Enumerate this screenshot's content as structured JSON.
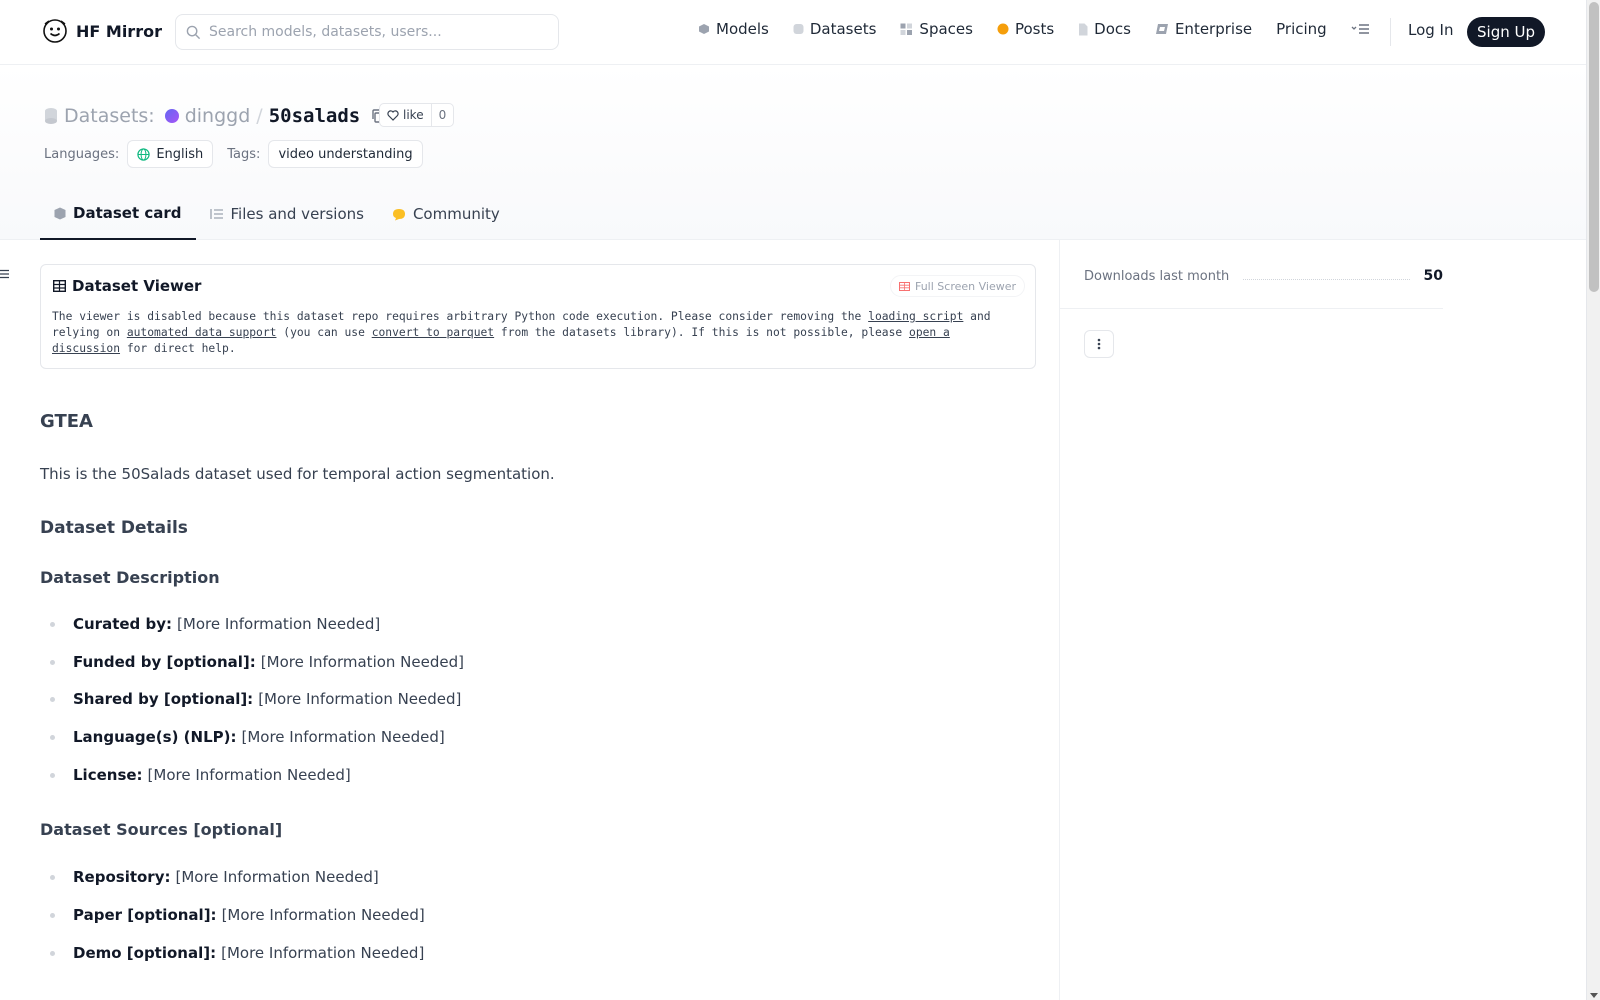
{
  "nav": {
    "brand": "HF Mirror",
    "search_placeholder": "Search models, datasets, users...",
    "items": [
      {
        "label": "Models",
        "icon": "models-icon"
      },
      {
        "label": "Datasets",
        "icon": "datasets-icon"
      },
      {
        "label": "Spaces",
        "icon": "spaces-icon"
      },
      {
        "label": "Posts",
        "icon": "posts-icon"
      },
      {
        "label": "Docs",
        "icon": "docs-icon"
      },
      {
        "label": "Enterprise",
        "icon": "enterprise-icon"
      },
      {
        "label": "Pricing",
        "icon": ""
      }
    ],
    "login": "Log In",
    "signup": "Sign Up"
  },
  "header": {
    "category": "Datasets:",
    "owner": "dinggd",
    "separator": "/",
    "repo": "50salads",
    "like_label": "like",
    "like_count": "0",
    "languages_label": "Languages:",
    "language": "English",
    "tags_label": "Tags:",
    "tag": "video understanding"
  },
  "tabs": [
    {
      "label": "Dataset card",
      "active": true
    },
    {
      "label": "Files and versions",
      "active": false
    },
    {
      "label": "Community",
      "active": false
    }
  ],
  "viewer": {
    "title": "Dataset Viewer",
    "fullscreen": "Full Screen Viewer",
    "msg1": "The viewer is disabled because this dataset repo requires arbitrary Python code execution. Please consider removing the ",
    "link1": "loading script",
    "msg2": " and relying on ",
    "link2": "automated data support",
    "msg3": " (you can use ",
    "link3": "convert to parquet",
    "msg4": " from the datasets library). If this is not possible, please ",
    "link4": "open a discussion",
    "msg5": " for direct help."
  },
  "card": {
    "title": "GTEA",
    "intro": "This is the 50Salads dataset used for temporal action segmentation.",
    "details_heading": "Dataset Details",
    "description_heading": "Dataset Description",
    "description_items": [
      {
        "key": "Curated by:",
        "value": "[More Information Needed]"
      },
      {
        "key": "Funded by [optional]:",
        "value": "[More Information Needed]"
      },
      {
        "key": "Shared by [optional]:",
        "value": "[More Information Needed]"
      },
      {
        "key": "Language(s) (NLP):",
        "value": "[More Information Needed]"
      },
      {
        "key": "License:",
        "value": "[More Information Needed]"
      }
    ],
    "sources_heading": "Dataset Sources [optional]",
    "sources_items": [
      {
        "key": "Repository:",
        "value": "[More Information Needed]"
      },
      {
        "key": "Paper [optional]:",
        "value": "[More Information Needed]"
      },
      {
        "key": "Demo [optional]:",
        "value": "[More Information Needed]"
      }
    ]
  },
  "sidebar": {
    "downloads_label": "Downloads last month",
    "downloads_value": "50"
  }
}
